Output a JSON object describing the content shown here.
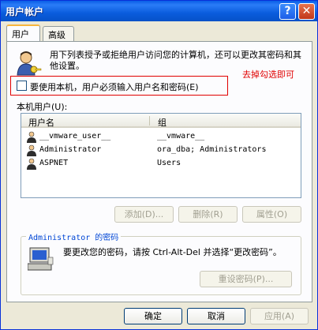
{
  "window": {
    "title": "用户帐户",
    "help": "?",
    "close": "✕"
  },
  "tabs": [
    {
      "label": "用户"
    },
    {
      "label": "高级"
    }
  ],
  "users_tab": {
    "description": "用下列表授予或拒绝用户访问您的计算机，还可以更改其密码和其他设置。",
    "annotation": "去掉勾选即可",
    "require_login_checkbox": {
      "label": "要使用本机，用户必须输入用户名和密码(E)",
      "checked": false
    },
    "local_users_label": "本机用户(U):",
    "columns": [
      "用户名",
      "组"
    ],
    "users": [
      {
        "name": "__vmware_user__",
        "group": "__vmware__"
      },
      {
        "name": "Administrator",
        "group": "ora_dba; Administrators"
      },
      {
        "name": "ASPNET",
        "group": "Users"
      }
    ],
    "buttons": {
      "add": "添加(D)...",
      "remove": "删除(R)",
      "properties": "属性(O)"
    },
    "password_group": {
      "title": "Administrator 的密码",
      "description": "要更改您的密码，请按 Ctrl-Alt-Del 并选择“更改密码”。",
      "reset_button": "重设密码(P)..."
    }
  },
  "footer": {
    "ok": "确定",
    "cancel": "取消",
    "apply": "应用(A)"
  }
}
